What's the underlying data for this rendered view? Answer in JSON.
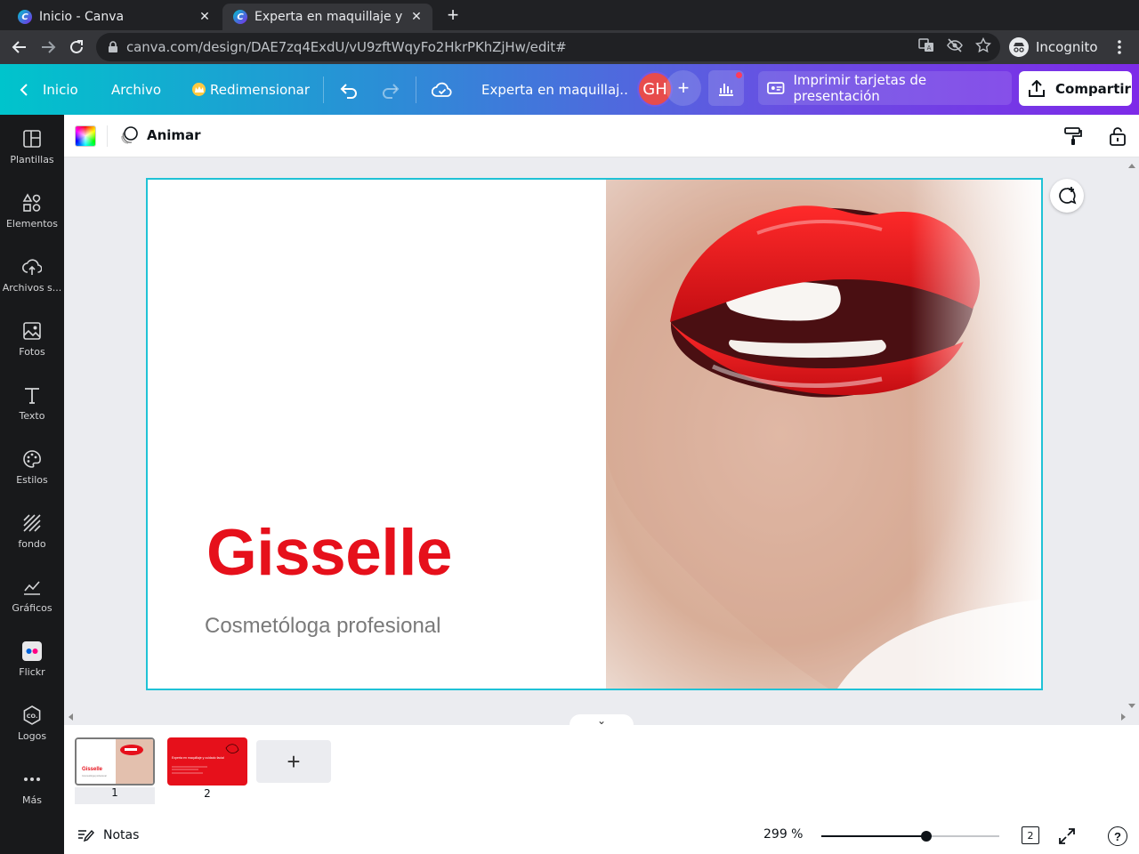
{
  "browser": {
    "tabs": [
      {
        "title": "Inicio - Canva",
        "favicon": "C"
      },
      {
        "title": "Experta en maquillaje y cu",
        "favicon": "C"
      }
    ],
    "url": "canva.com/design/DAE7zq4ExdU/vU9zftWqyFo2HkrPKhZjHw/edit#",
    "incognito_label": "Incognito"
  },
  "header": {
    "home_label": "Inicio",
    "file_label": "Archivo",
    "resize_label": "Redimensionar",
    "doc_title": "Experta en maquillaj..",
    "avatar_initials": "GH",
    "print_label": "Imprimir tarjetas de presentación",
    "share_label": "Compartir"
  },
  "sidebar": {
    "items": [
      {
        "label": "Plantillas",
        "icon": "templates-icon"
      },
      {
        "label": "Elementos",
        "icon": "elements-icon"
      },
      {
        "label": "Archivos s...",
        "icon": "uploads-icon"
      },
      {
        "label": "Fotos",
        "icon": "photos-icon"
      },
      {
        "label": "Texto",
        "icon": "text-icon"
      },
      {
        "label": "Estilos",
        "icon": "styles-icon"
      },
      {
        "label": "fondo",
        "icon": "background-icon"
      },
      {
        "label": "Gráficos",
        "icon": "charts-icon"
      },
      {
        "label": "Flickr",
        "icon": "flickr-icon"
      },
      {
        "label": "Logos",
        "icon": "logos-icon"
      },
      {
        "label": "Más",
        "icon": "more-icon"
      }
    ]
  },
  "object_toolbar": {
    "animate_label": "Animar"
  },
  "design": {
    "headline": "Gisselle",
    "subline": "Cosmetóloga profesional",
    "headline_color": "#e6101b"
  },
  "pages": {
    "items": [
      {
        "number": "1",
        "headline": "Gisselle",
        "subline": "Cosmetóloga profesional"
      },
      {
        "number": "2",
        "text": "Experta en maquillaje y cuidado facial"
      }
    ]
  },
  "footer": {
    "notes_label": "Notas",
    "zoom": "299 %",
    "zoom_fraction": 0.59,
    "page_count": "2",
    "help_label": "?"
  },
  "colors": {
    "accent": "#1fc2d6",
    "brand_gradient_start": "#00c4cc",
    "brand_gradient_end": "#7d2ae8",
    "sidebar_bg": "#18191b"
  }
}
